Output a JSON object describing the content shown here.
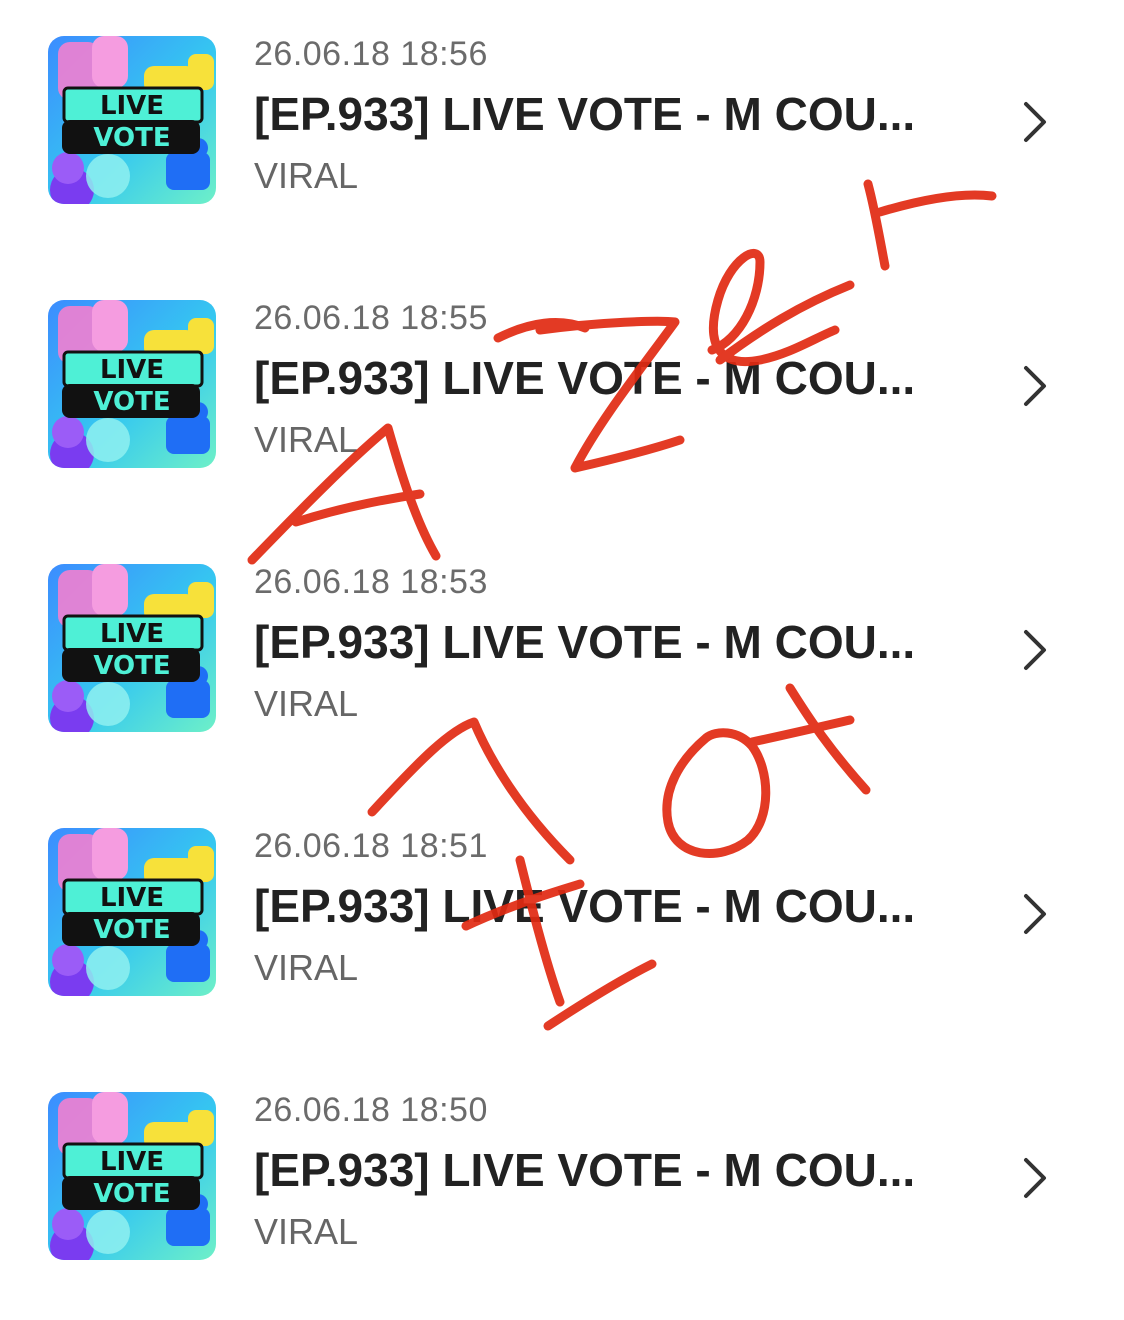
{
  "items": [
    {
      "date": "26.06.18 18:56",
      "title": "[EP.933] LIVE VOTE - M COU...",
      "channel": "VIRAL",
      "thumbnail": {
        "line1": "LIVE",
        "line2": "VOTE"
      }
    },
    {
      "date": "26.06.18 18:55",
      "title": "[EP.933] LIVE VOTE - M COU...",
      "channel": "VIRAL",
      "thumbnail": {
        "line1": "LIVE",
        "line2": "VOTE"
      }
    },
    {
      "date": "26.06.18 18:53",
      "title": "[EP.933] LIVE VOTE - M COU...",
      "channel": "VIRAL",
      "thumbnail": {
        "line1": "LIVE",
        "line2": "VOTE"
      }
    },
    {
      "date": "26.06.18 18:51",
      "title": "[EP.933] LIVE VOTE - M COU...",
      "channel": "VIRAL",
      "thumbnail": {
        "line1": "LIVE",
        "line2": "VOTE"
      }
    },
    {
      "date": "26.06.18 18:50",
      "title": "[EP.933] LIVE VOTE - M COU...",
      "channel": "VIRAL",
      "thumbnail": {
        "line1": "LIVE",
        "line2": "VOTE"
      }
    }
  ],
  "icons": {
    "row_arrow": "chevron-right-icon"
  },
  "colors": {
    "annotation": "#e12a12",
    "title_text": "#222222",
    "date_text": "#6b6b6b"
  }
}
